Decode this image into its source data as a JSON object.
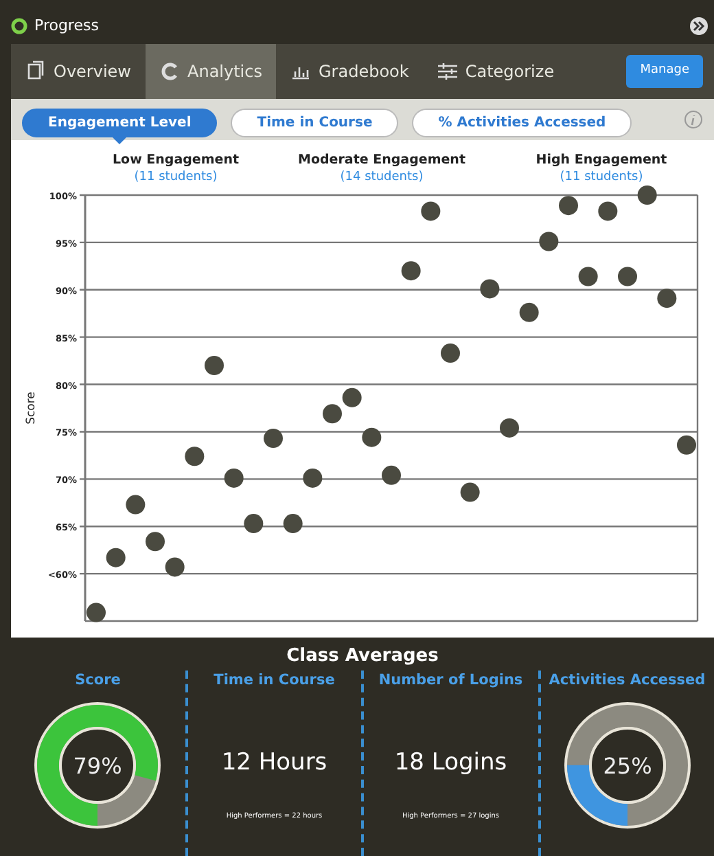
{
  "window": {
    "title": "Progress"
  },
  "tabs": [
    {
      "label": "Overview",
      "kind": "overview",
      "selected": false
    },
    {
      "label": "Analytics",
      "kind": "analytics",
      "selected": true
    },
    {
      "label": "Gradebook",
      "kind": "gradebook",
      "selected": false
    },
    {
      "label": "Categorize",
      "kind": "categorize",
      "selected": false
    }
  ],
  "manage_button": "Manage",
  "subtabs": [
    {
      "label": "Engagement Level",
      "selected": true
    },
    {
      "label": "Time in Course",
      "selected": false
    },
    {
      "label": "% Activities Accessed",
      "selected": false
    }
  ],
  "groups": [
    {
      "title": "Low Engagement",
      "count": "(11 students)"
    },
    {
      "title": "Moderate Engagement",
      "count": "(14 students)"
    },
    {
      "title": "High Engagement",
      "count": "(11 students)"
    }
  ],
  "chart_data": {
    "type": "scatter",
    "ylabel": "Score",
    "grid": true,
    "ylim": [
      55,
      100
    ],
    "yticks": [
      {
        "value": 100,
        "label": "100%"
      },
      {
        "value": 95,
        "label": "95%"
      },
      {
        "value": 90,
        "label": "90%"
      },
      {
        "value": 85,
        "label": "85%"
      },
      {
        "value": 80,
        "label": "80%"
      },
      {
        "value": 75,
        "label": "75%"
      },
      {
        "value": 70,
        "label": "70%"
      },
      {
        "value": 65,
        "label": "65%"
      },
      {
        "value": 60,
        "label": "<60%"
      }
    ],
    "categories": [
      null,
      null,
      null,
      null,
      null,
      null,
      null,
      null,
      null,
      null,
      null,
      null,
      null,
      null,
      null,
      null,
      null,
      null,
      null,
      null,
      null,
      null,
      null,
      null,
      null,
      null,
      null,
      null,
      null,
      null,
      null
    ],
    "series": [
      {
        "color": "#4a4a40",
        "values": [
          55.9,
          61.7,
          67.3,
          63.4,
          60.7,
          72.4,
          82,
          70.1,
          65.3,
          74.3,
          65.3,
          70.1,
          76.9,
          78.6,
          74.4,
          70.4,
          92,
          98.3,
          83.3,
          68.6,
          90.1,
          75.4,
          87.6,
          95.1,
          98.9,
          91.4,
          98.3,
          91.4,
          100,
          89.1,
          73.6
        ]
      }
    ]
  },
  "averages": {
    "title": "Class Averages",
    "items": [
      {
        "kind": "donut",
        "label": "Score",
        "value": "79%",
        "level": 0.79,
        "color": "#3cc43c"
      },
      {
        "kind": "stat",
        "label": "Time in Course",
        "value": "12 Hours",
        "note": "High Performers = 22 hours"
      },
      {
        "kind": "stat",
        "label": "Number of Logins",
        "value": "18 Logins",
        "note": "High Performers = 27 logins"
      },
      {
        "kind": "donut",
        "label": "Activities Accessed",
        "value": "25%",
        "level": 0.25,
        "color": "#3f95e0"
      }
    ]
  }
}
